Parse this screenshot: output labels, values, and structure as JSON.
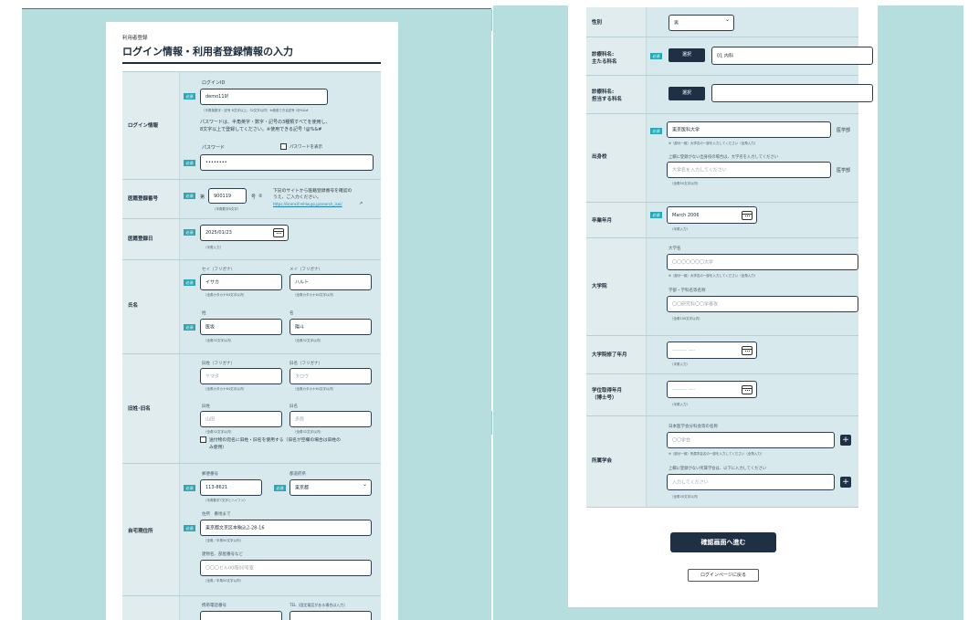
{
  "left": {
    "caption": "利用者登録",
    "title": "ログイン情報・利用者登録情報の入力",
    "req": "必須",
    "login": {
      "th": "ログイン情報",
      "id_label": "ログインID",
      "id_value": "demo119!",
      "id_hint": "（半角英数字・記号 8文字以上、32文字以内）※使用できる記号 !@%&#",
      "pw_desc1": "パスワードは、半角英字・数字・記号の3種類すべてを使用し、",
      "pw_desc2": "8文字以上で登録してください。※使用できる記号 !@%&#",
      "pw_label": "パスワード",
      "pw_show": "パスワードを表示",
      "pw_value": "••••••••"
    },
    "med_num": {
      "th": "医籍登録番号",
      "prefix": "第",
      "value": "900119",
      "suffix": "号",
      "info_icon": "②",
      "hint": "（半角数字6文字）",
      "desc1": "下記のサイトから医籍登録番号を確認の",
      "desc2": "うえ、ご入力ください。",
      "link": "https://licensif.mhlw.go.jp/search_isei/"
    },
    "med_date": {
      "th": "医籍登録日",
      "value": "2025/01/23",
      "hint": "（半角入力）"
    },
    "name": {
      "th": "氏名",
      "sei_kana_label": "セイ（フリガナ）",
      "sei_kana": "イサカ",
      "mei_kana_label": "メイ（フリガナ）",
      "mei_kana": "ハルト",
      "kana_hint": "（全角カタカナ64文字以内）",
      "sei_label": "姓",
      "sei": "医坂",
      "mei_label": "名",
      "mei": "陽斗",
      "hint": "（全角32文字以内）"
    },
    "old_name": {
      "th": "旧姓･旧名",
      "sei_kana_label": "旧姓（フリガナ）",
      "sei_kana_ph": "ヤマダ",
      "mei_kana_label": "旧名（フリガナ）",
      "mei_kana_ph": "タロウ",
      "kana_hint": "（全角カタカナ64文字以内）",
      "sei_label": "旧姓",
      "sei_ph": "山田",
      "mei_label": "旧名",
      "mei_ph": "多郎",
      "hint": "（全角32文字以内）",
      "check1": "送付物の宛名に旧姓・旧名を使用する（旧名が空欄の場合は旧姓の",
      "check2": "み使用）"
    },
    "address": {
      "th": "自宅現住所",
      "zip_label": "郵便番号",
      "zip": "113-8621",
      "zip_hint": "（半角数字7文字とハイフン）",
      "pref_label": "都道府県",
      "pref": "東京都",
      "addr_label": "住所　番地まで",
      "addr": "東京都文京区本駒込2-28-16",
      "addr_hint": "（全角／半角50文字以内）",
      "bld_label": "建物名、部屋番号など",
      "bld_ph": "〇〇〇ビル00階00号室",
      "bld_hint": "（全角／半角50文字以内）"
    },
    "phone": {
      "mobile_label": "携帯電話番号",
      "tel_label": "TEL（固定電話がある場合は入力）"
    }
  },
  "right": {
    "req": "必須",
    "gender": {
      "th": "性別",
      "value": "男"
    },
    "dept_main": {
      "th1": "診療科名:",
      "th2": "主たる科名",
      "btn": "選択",
      "value": "01 内科"
    },
    "dept_sub": {
      "th1": "診療科名:",
      "th2": "担当する科名",
      "btn": "選択"
    },
    "school": {
      "th": "出身校",
      "value": "東京医科大学",
      "suffix": "医学部",
      "note": "※（部分一致）大学名の一部を入力してください（全角入力）",
      "other_label": "上欄に登録がない出身校の場合は、大学名を入力してください",
      "other_ph": "大学名を入力してください",
      "hint": "（全角50文字以内）"
    },
    "grad": {
      "th": "卒業年月",
      "value": "March 2006",
      "hint": "（半角入力）"
    },
    "grad_school": {
      "th": "大学院",
      "univ_label": "大学名",
      "univ_ph": "〇〇〇〇〇〇〇大学",
      "note": "※（部分一致）大学名の一部を入力してください（全角入力）",
      "dept_label": "学部・学科名等名称",
      "dept_ph": "〇〇研究科〇〇学専攻",
      "dept_hint": "（全角100文字以内）"
    },
    "gs_end": {
      "th": "大学院修了年月",
      "ph": "--------- ----",
      "hint": "（半角入力）"
    },
    "degree": {
      "th1": "学位取得年月",
      "th2": "（博士号）",
      "ph": "--------- ----",
      "hint": "（半角入力）"
    },
    "society": {
      "th": "所属学会",
      "label": "日本医学会分科会等の名称",
      "ph": "〇〇学会",
      "note": "※（部分一致）所属学会名の一部を入力してください（全角入力）",
      "other_label": "上欄に登録がない所属学会は、以下に入力してください",
      "other_ph": "入力してください",
      "hint": "（全角30文字以内）"
    },
    "confirm_btn": "確認画面へ進む",
    "back_btn": "ログインページに戻る"
  }
}
